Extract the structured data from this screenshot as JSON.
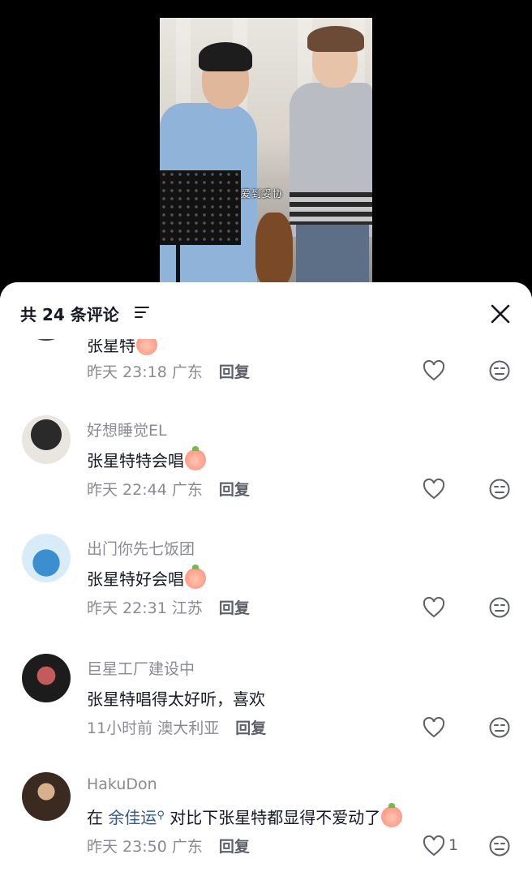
{
  "video": {
    "subtitle": "爱到妥协"
  },
  "sheet": {
    "title": "共 24 条评论"
  },
  "comments": [
    {
      "username": "",
      "content": "张星特",
      "time": "昨天 23:18",
      "location": "广东",
      "reply": "回复",
      "likes": "",
      "emoji": "peach-emoji"
    },
    {
      "username": "好想睡觉EL",
      "content": "张星特特会唱",
      "time": "昨天 22:44",
      "location": "广东",
      "reply": "回复",
      "likes": "",
      "emoji": "peach-emoji"
    },
    {
      "username": "出门你先七饭团",
      "content": "张星特好会唱",
      "time": "昨天 22:31",
      "location": "江苏",
      "reply": "回复",
      "likes": "",
      "emoji": "peach-heart-eyes-emoji"
    },
    {
      "username": "巨星工厂建设中",
      "content": "张星特唱得太好听，喜欢",
      "time": "11小时前",
      "location": "澳大利亚",
      "reply": "回复",
      "likes": ""
    },
    {
      "username": "HakuDon",
      "content_prefix": "在 ",
      "mention": "余佳运",
      "content_suffix": " 对比下张星特都显得不爱动了",
      "time": "昨天 23:50",
      "location": "广东",
      "reply": "回复",
      "likes": "1",
      "emoji": "peach-crying-emoji"
    }
  ],
  "colors": {
    "primary_text": "#161823",
    "secondary_text": "#8a8b91",
    "mention": "#2e5a97"
  }
}
